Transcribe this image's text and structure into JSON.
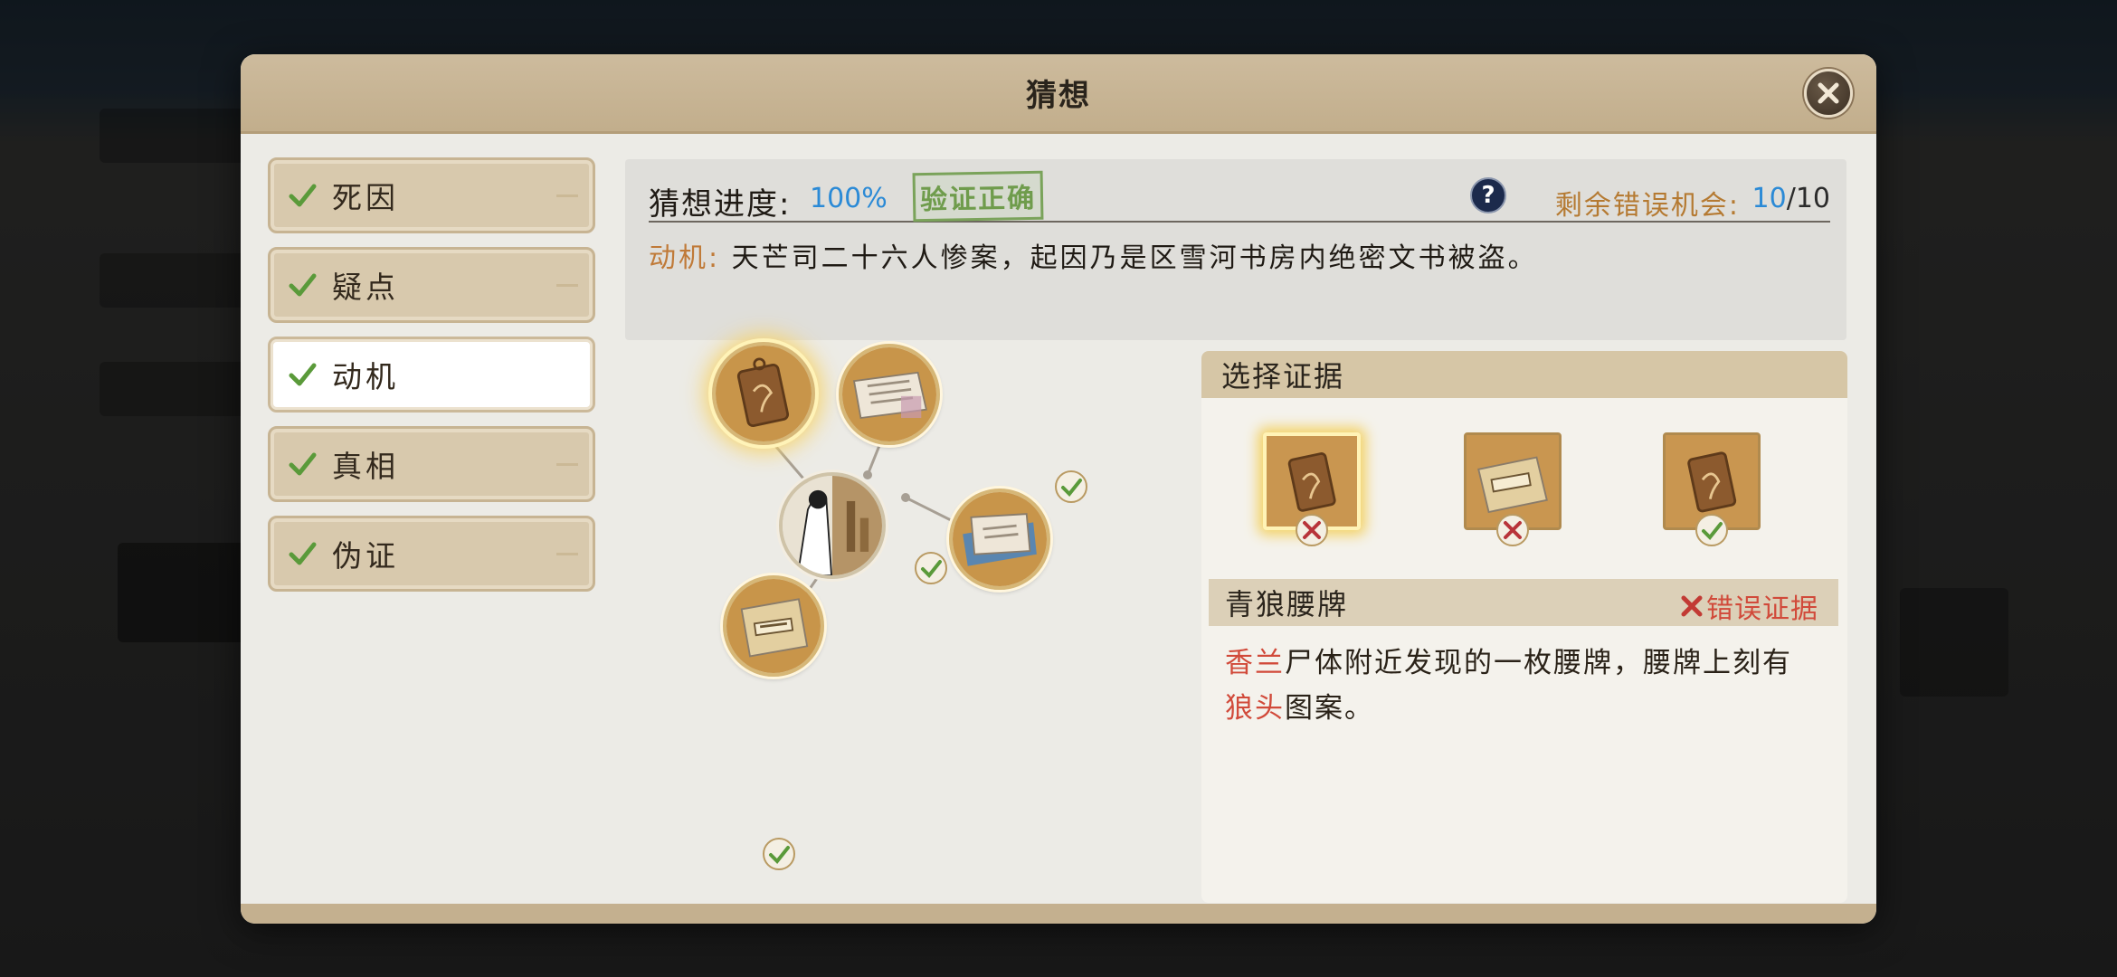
{
  "dialog": {
    "title": "猜想"
  },
  "tabs": [
    {
      "label": "死因",
      "checked": true,
      "active": false
    },
    {
      "label": "疑点",
      "checked": true,
      "active": false
    },
    {
      "label": "动机",
      "checked": true,
      "active": true
    },
    {
      "label": "真相",
      "checked": true,
      "active": false
    },
    {
      "label": "伪证",
      "checked": true,
      "active": false
    }
  ],
  "progress": {
    "label": "猜想进度:",
    "value": "100%",
    "stamp": "验证正确",
    "chances_label": "剩余错误机会:",
    "chances_current": "10",
    "chances_total": "/10"
  },
  "motive": {
    "key": "动机:",
    "text": "天芒司二十六人惨案，起因乃是区雪河书房内绝密文书被盗。"
  },
  "evidence": {
    "header": "选择证据",
    "cards": [
      {
        "icon": "wolf-token-icon",
        "status": "wrong",
        "selected": true
      },
      {
        "icon": "scroll-paper-icon",
        "status": "wrong",
        "selected": false
      },
      {
        "icon": "wolf-token-icon",
        "status": "correct",
        "selected": false
      }
    ],
    "detail": {
      "name": "青狼腰牌",
      "tag": "错误证据",
      "desc_parts": [
        {
          "text": "香兰",
          "highlight": true
        },
        {
          "text": "尸体附近发现的一枚腰牌，腰牌上刻有",
          "highlight": false
        },
        {
          "text": "狼头",
          "highlight": true
        },
        {
          "text": "图案。",
          "highlight": false
        }
      ]
    }
  },
  "graph": {
    "nodes": [
      {
        "icon": "wolf-token-icon",
        "checked": true,
        "highlighted": true
      },
      {
        "icon": "book-scroll-icon",
        "checked": true,
        "highlighted": false
      },
      {
        "icon": "map-letter-icon",
        "checked": true,
        "highlighted": false
      },
      {
        "icon": "scroll-paper-icon",
        "checked": true,
        "highlighted": false
      }
    ],
    "center_icon": "character-portrait-icon"
  },
  "colors": {
    "accent_blue": "#2b8ad6",
    "wrong_red": "#d14a3a",
    "check_green": "#5a9a3a",
    "gold": "#b57a32"
  }
}
